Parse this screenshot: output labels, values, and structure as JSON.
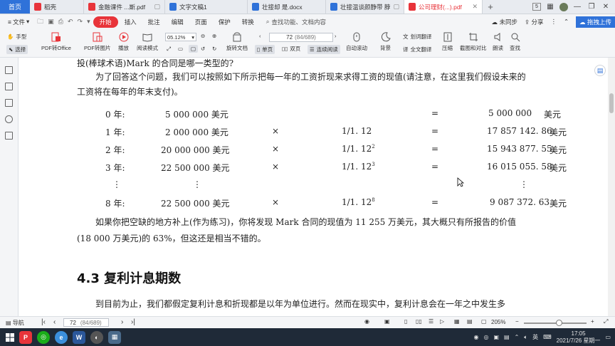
{
  "tabs": {
    "home": "首页",
    "items": [
      {
        "label": "稻壳",
        "color": "#e8343a"
      },
      {
        "label": "金融课件 ...斯.pdf",
        "color": "#e8343a"
      },
      {
        "label": "文字文稿1",
        "color": "#2f72d9"
      },
      {
        "label": "壮接却 是.docx",
        "color": "#2f72d9"
      },
      {
        "label": "壮接温谈颜静带 脖",
        "color": "#2f72d9"
      },
      {
        "label": "公司理财(...).pdf",
        "color": "#e8343a"
      }
    ],
    "add": "+"
  },
  "window": {
    "badge": "5"
  },
  "menubar": {
    "file": "文件",
    "start": "开始",
    "items": [
      "插入",
      "批注",
      "编辑",
      "页面",
      "保护",
      "转换"
    ],
    "search": "查找功能、文档内容",
    "sync": "未同步",
    "share": "分享",
    "upload": "拖拽上传"
  },
  "ribbon": {
    "hand": "手型",
    "select": "选择",
    "to_office": "PDF转Office",
    "to_image": "PDF转图片",
    "play": "播放",
    "read_mode": "阅读模式",
    "zoom": "05.12%",
    "rotate": "旋转文档",
    "single": "单页",
    "double": "双页",
    "continuous": "连续阅读",
    "page_input": "72",
    "page_info": "(84/689)",
    "auto_scroll": "自动滚动",
    "background": "背景",
    "translate_word": "划词翻译",
    "translate_all": "全文翻译",
    "compress": "压缩",
    "screenshot": "截图和对比",
    "read_aloud": "朗读",
    "find": "查找"
  },
  "document": {
    "line1": "投(棒球术语)Mark 的合同是哪一类型的?",
    "line2": "为了回答这个问题，我们可以按照如下所示把每一年的工资折现来求得工资的现值(请注意，在这里我们假设未来的",
    "line3": "工资将在每年的年末支付)。",
    "rows": [
      {
        "year": "0 年:",
        "salary": "5 000 000 美元",
        "op": "",
        "factor": "",
        "exp": "",
        "eq": "=",
        "value": "5 000 000",
        "unit": "美元"
      },
      {
        "year": "1 年:",
        "salary": "2 000 000 美元",
        "op": "×",
        "factor": "1/1. 12",
        "exp": "",
        "eq": "=",
        "value": "17 857 142. 86",
        "unit": "美元"
      },
      {
        "year": "2 年:",
        "salary": "20 000 000 美元",
        "op": "×",
        "factor": "1/1. 12",
        "exp": "2",
        "eq": "=",
        "value": "15 943 877. 55",
        "unit": "美元"
      },
      {
        "year": "3 年:",
        "salary": "22 500 000 美元",
        "op": "×",
        "factor": "1/1. 12",
        "exp": "3",
        "eq": "=",
        "value": "16 015 055. 58",
        "unit": "美元"
      },
      {
        "year": "⋮",
        "salary": "⋮",
        "op": "",
        "factor": "",
        "exp": "",
        "eq": "",
        "value": "⋮",
        "unit": ""
      },
      {
        "year": "8 年:",
        "salary": "22 500 000 美元",
        "op": "×",
        "factor": "1/1. 12",
        "exp": "8",
        "eq": "=",
        "value": "9 087 372. 63",
        "unit": "美元"
      }
    ],
    "line4": "如果你把空缺的地方补上(作为练习)，你将发现 Mark 合同的现值为 11 255 万美元，其大概只有所报告的价值",
    "line5": "(18 000 万美元)的 63%，但这还是相当不错的。",
    "section": "4.3    复利计息期数",
    "line6": "到目前为止，我们都假定复利计息和折现都是以年为单位进行。然而在现实中，复利计息会在一年之中发生多"
  },
  "statusbar": {
    "nav": "导航",
    "page": "72",
    "page_total": "(84/689)",
    "zoom": "205%"
  },
  "taskbar": {
    "lang": "英",
    "time": "17:05",
    "date": "2021/7/26 星期一"
  }
}
